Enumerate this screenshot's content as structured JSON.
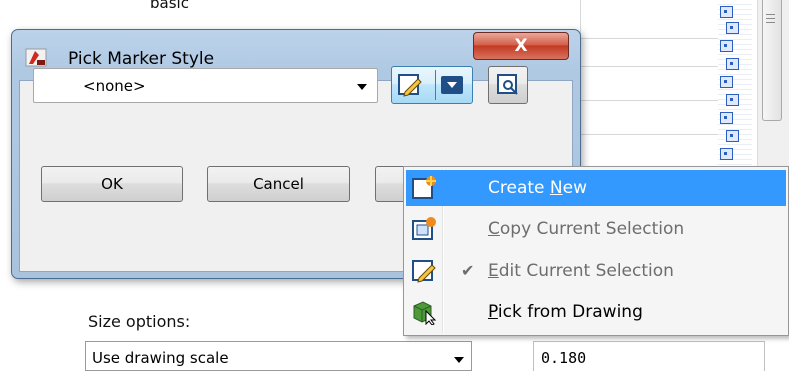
{
  "background": {
    "top_label": "basic",
    "size_options_label": "Size options:",
    "size_combo_value": "Use drawing scale",
    "size_value": "0.180"
  },
  "dialog": {
    "title": "Pick Marker Style",
    "close_glyph": "X",
    "style_combo_value": "<none>",
    "ok_label": "OK",
    "cancel_label": "Cancel"
  },
  "menu": {
    "items": [
      {
        "pre": "Create ",
        "key": "N",
        "post": "ew",
        "state": "highlighted",
        "icon": "create-new-icon"
      },
      {
        "pre": "",
        "key": "C",
        "post": "opy Current Selection",
        "state": "disabled",
        "icon": "copy-style-icon"
      },
      {
        "pre": "",
        "key": "E",
        "post": "dit Current Selection",
        "state": "disabled",
        "checked": true,
        "icon": "edit-style-icon"
      },
      {
        "pre": "",
        "key": "P",
        "post": "ick from Drawing",
        "state": "enabled",
        "icon": "pick-from-drawing-icon"
      }
    ]
  },
  "colors": {
    "menu_highlight": "#3399ff",
    "dialog_frame": "#b0c9e3",
    "close_button": "#c33a22"
  }
}
